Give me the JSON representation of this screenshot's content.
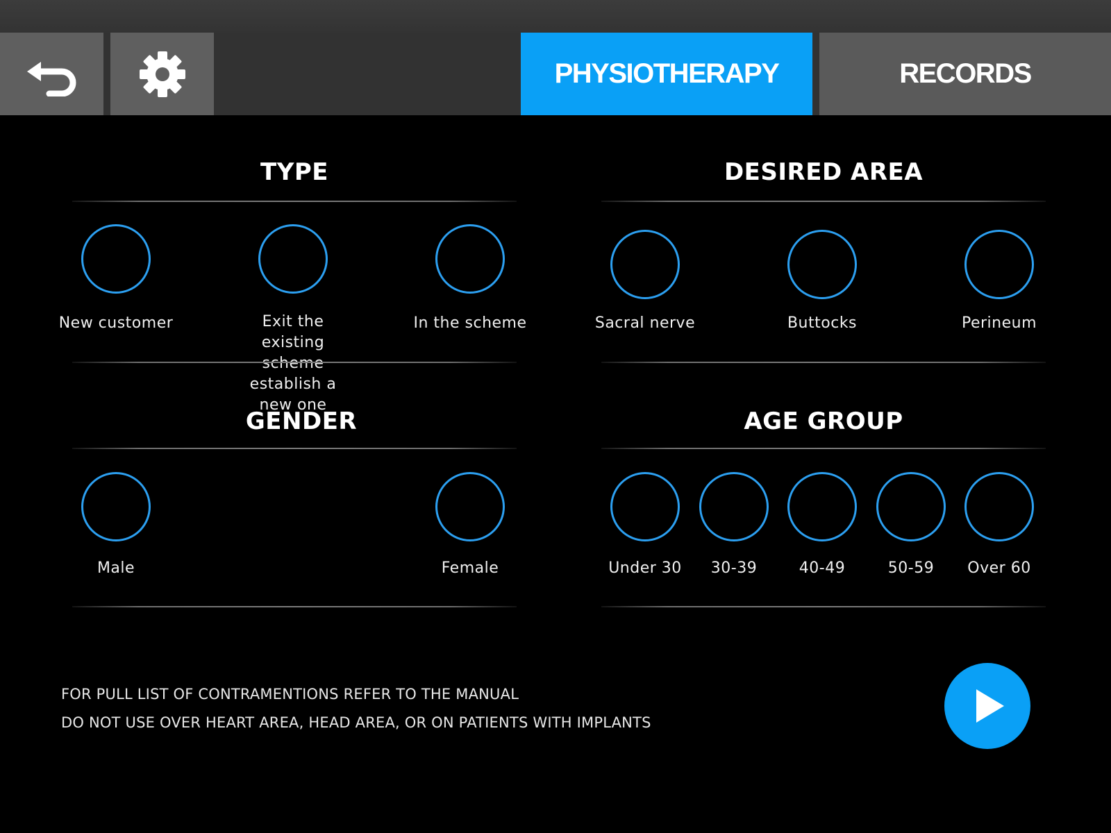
{
  "header": {
    "back_icon": "back-arrow-icon",
    "settings_icon": "gear-icon",
    "tabs": [
      {
        "label": "PHYSIOTHERAPY",
        "active": true
      },
      {
        "label": "RECORDS",
        "active": false
      }
    ]
  },
  "type": {
    "title": "TYPE",
    "options": [
      {
        "label": "New customer"
      },
      {
        "label": "Exit the existing scheme\nestablish a new one"
      },
      {
        "label": "In the scheme"
      }
    ]
  },
  "area": {
    "title": "DESIRED AREA",
    "options": [
      {
        "label": "Sacral nerve"
      },
      {
        "label": "Buttocks"
      },
      {
        "label": "Perineum"
      }
    ]
  },
  "gender": {
    "title": "GENDER",
    "options": [
      {
        "label": "Male"
      },
      {
        "label": "Female"
      }
    ]
  },
  "age": {
    "title": "AGE GROUP",
    "options": [
      {
        "label": "Under 30"
      },
      {
        "label": "30-39"
      },
      {
        "label": "40-49"
      },
      {
        "label": "50-59"
      },
      {
        "label": "Over 60"
      }
    ]
  },
  "notes": {
    "line1": "FOR PULL LIST OF CONTRAMENTIONS REFER TO THE MANUAL",
    "line2": "DO NOT USE OVER HEART AREA, HEAD AREA, OR ON PATIENTS WITH IMPLANTS"
  },
  "play_icon": "play-icon",
  "colors": {
    "accent": "#0aa0f6",
    "ring": "#2c9ff0",
    "background": "#000000",
    "tab_inactive": "#5a5a5a"
  }
}
